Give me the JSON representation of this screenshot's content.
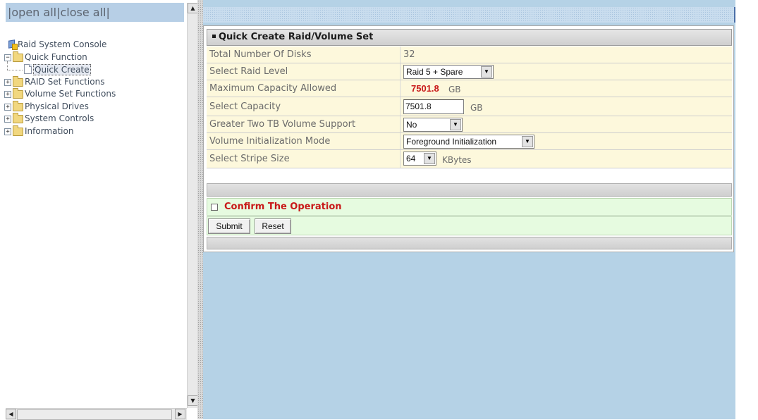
{
  "tree_header": {
    "open_all": "open all",
    "close_all": "close all"
  },
  "tree": {
    "root": "Raid System Console",
    "items": [
      {
        "label": "Quick Function",
        "expander": "−"
      },
      {
        "label": "Quick Create",
        "selected": true
      },
      {
        "label": "RAID Set Functions",
        "expander": "+"
      },
      {
        "label": "Volume Set Functions",
        "expander": "+"
      },
      {
        "label": "Physical Drives",
        "expander": "+"
      },
      {
        "label": "System Controls",
        "expander": "+"
      },
      {
        "label": "Information",
        "expander": "+"
      }
    ]
  },
  "form": {
    "title": "Quick Create Raid/Volume Set",
    "rows": [
      {
        "label": "Total Number Of Disks",
        "value": "32"
      },
      {
        "label": "Select Raid Level",
        "value": "Raid 5 + Spare"
      },
      {
        "label": "Maximum Capacity Allowed",
        "value": "7501.8",
        "unit": "GB"
      },
      {
        "label": "Select Capacity",
        "value": "7501.8",
        "unit": "GB"
      },
      {
        "label": "Greater Two TB Volume Support",
        "value": "No"
      },
      {
        "label": "Volume Initialization Mode",
        "value": "Foreground Initialization"
      },
      {
        "label": "Select Stripe Size",
        "value": "64",
        "unit": "KBytes"
      }
    ],
    "confirm_label": "Confirm The Operation",
    "confirm_checked": false,
    "submit_label": "Submit",
    "reset_label": "Reset"
  },
  "colors": {
    "frame_bg": "#b5d2e6",
    "row_bg": "#fdf8dc",
    "confirm_bg": "#e6fbe0",
    "confirm_text": "#c81818",
    "max_capacity_value": "#c81818"
  },
  "icons": {
    "console": "console-icon",
    "folder": "folder-icon",
    "document": "document-icon"
  }
}
